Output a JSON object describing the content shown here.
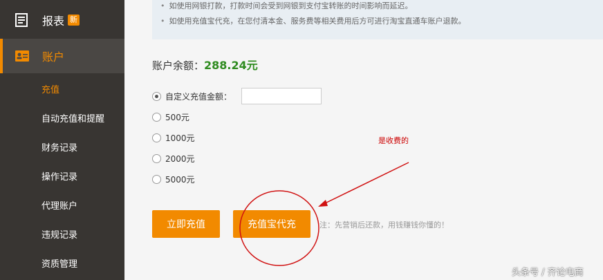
{
  "sidebar": {
    "reports_label": "报表",
    "new_badge": "新",
    "account_label": "账户",
    "sub_items": [
      "充值",
      "自动充值和提醒",
      "财务记录",
      "操作记录",
      "代理账户",
      "违规记录",
      "资质管理"
    ]
  },
  "notice": {
    "line1": "如使用网银打款，打款时间会受到网银到支付宝转账的时间影响而延迟。",
    "line2": "如使用充值宝代充，在您付清本金、服务费等相关费用后方可进行淘宝直通车账户退款。"
  },
  "balance": {
    "label": "账户余额：",
    "amount": "288.24元"
  },
  "options": {
    "custom": "自定义充值金额：",
    "o500": "500元",
    "o1000": "1000元",
    "o2000": "2000元",
    "o5000": "5000元"
  },
  "buttons": {
    "recharge": "立即充值",
    "proxy": "充值宝代充"
  },
  "note": "注：先营销后还款，用钱赚钱你懂的！",
  "annotation": "是收费的",
  "watermark": "头条号 / 齐论电商",
  "colors": {
    "accent": "#f28a00",
    "sidebar_bg": "#383532",
    "balance_green": "#2e8b1f",
    "annotation_red": "#cc0000"
  }
}
